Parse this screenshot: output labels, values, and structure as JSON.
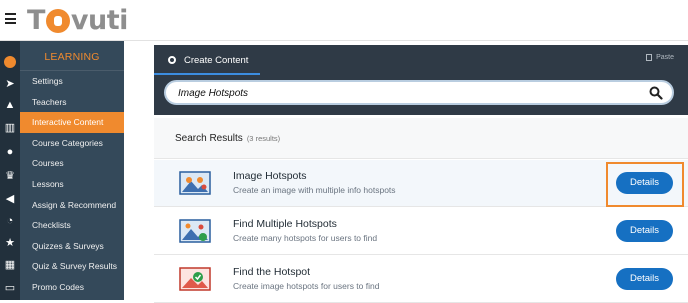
{
  "app": {
    "logo_text_1": "T",
    "logo_text_2": "vuti"
  },
  "sidebar": {
    "section": "LEARNING",
    "items": [
      {
        "label": "Settings"
      },
      {
        "label": "Teachers"
      },
      {
        "label": "Interactive Content",
        "active": true
      },
      {
        "label": "Course Categories"
      },
      {
        "label": "Courses"
      },
      {
        "label": "Lessons"
      },
      {
        "label": "Assign & Recommend"
      },
      {
        "label": "Checklists"
      },
      {
        "label": "Quizzes & Surveys"
      },
      {
        "label": "Quiz & Survey Results"
      },
      {
        "label": "Promo Codes"
      }
    ]
  },
  "iconbar": [
    "logo-icon",
    "rocket-icon",
    "graduation-cap-icon",
    "bar-chart-icon",
    "users-icon",
    "trophy-icon",
    "megaphone-icon",
    "rss-icon",
    "star-icon",
    "table-icon",
    "card-icon"
  ],
  "panel": {
    "tab_label": "Create Content",
    "paste_label": "Paste"
  },
  "search": {
    "value": "Image Hotspots",
    "placeholder": ""
  },
  "results": {
    "heading": "Search Results",
    "count": "(3 results)",
    "items": [
      {
        "title": "Image Hotspots",
        "description": "Create an image with multiple info hotspots",
        "button": "Details"
      },
      {
        "title": "Find Multiple Hotspots",
        "description": "Create many hotspots for users to find",
        "button": "Details"
      },
      {
        "title": "Find the Hotspot",
        "description": "Create image hotspots for users to find",
        "button": "Details"
      }
    ]
  },
  "colors": {
    "accent": "#f08a2e",
    "button": "#1670c2",
    "sidebar_bg": "#34495a",
    "panel_bg": "#2f3a46"
  }
}
